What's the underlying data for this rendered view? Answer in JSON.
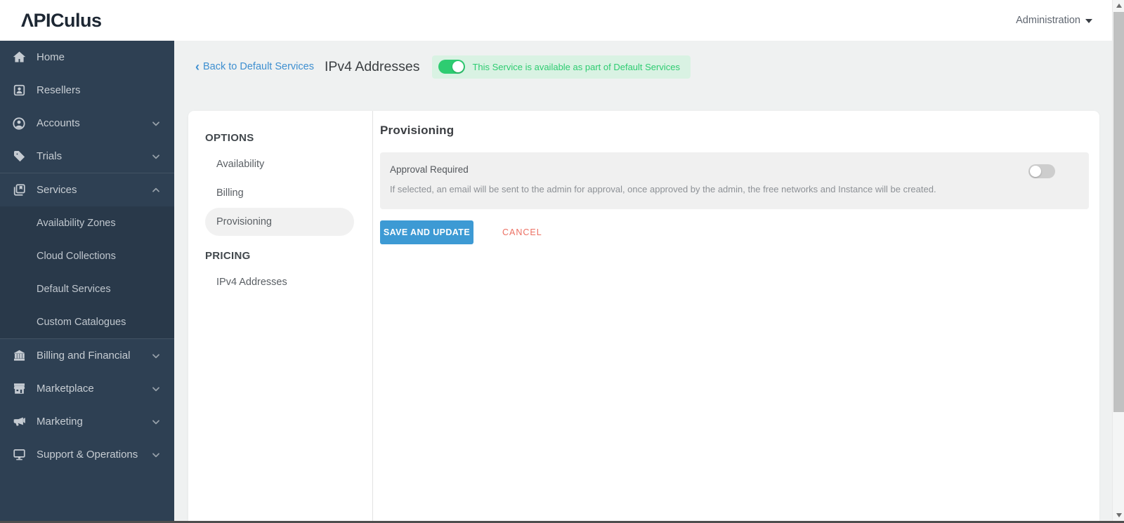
{
  "topbar": {
    "logo_text": "ΛPICulus",
    "admin_label": "Administration"
  },
  "sidebar": {
    "items": [
      {
        "label": "Home",
        "icon": "home"
      },
      {
        "label": "Resellers",
        "icon": "resellers"
      },
      {
        "label": "Accounts",
        "icon": "accounts",
        "chevron": "down"
      },
      {
        "label": "Trials",
        "icon": "trials",
        "chevron": "down"
      },
      {
        "label": "Services",
        "icon": "services",
        "chevron": "up",
        "expanded": true
      },
      {
        "label": "Billing and Financial",
        "icon": "billing",
        "chevron": "down"
      },
      {
        "label": "Marketplace",
        "icon": "marketplace",
        "chevron": "down"
      },
      {
        "label": "Marketing",
        "icon": "marketing",
        "chevron": "down"
      },
      {
        "label": "Support & Operations",
        "icon": "support",
        "chevron": "down"
      }
    ],
    "services_submenu": [
      "Availability Zones",
      "Cloud Collections",
      "Default Services",
      "Custom Catalogues"
    ]
  },
  "page_header": {
    "back_link": "Back to Default Services",
    "back_chevron": "‹",
    "title": "IPv4 Addresses",
    "service_badge": {
      "text": "This Service is available as part of Default Services",
      "toggle_state": "on"
    }
  },
  "options_menu": {
    "section1_header": "OPTIONS",
    "section1_items": [
      {
        "label": "Availability",
        "selected": false
      },
      {
        "label": "Billing",
        "selected": false
      },
      {
        "label": "Provisioning",
        "selected": true
      }
    ],
    "section2_header": "PRICING",
    "section2_items": [
      {
        "label": "IPv4 Addresses",
        "selected": false
      }
    ]
  },
  "content": {
    "heading": "Provisioning",
    "approval": {
      "label": "Approval Required",
      "description": "If selected, an email will be sent to the admin for approval, once approved by the admin, the free networks and Instance will be created.",
      "toggle_state": "off"
    },
    "save_label": "SAVE AND UPDATE",
    "cancel_label": "CANCEL"
  },
  "colors": {
    "sidebar_bg": "#2e4053",
    "accent_blue": "#3d9ad4",
    "link_blue": "#3e8fd0",
    "success_green": "#2ecc71",
    "badge_bg": "#d9f2e3",
    "cancel_red": "#ec7063",
    "page_bg": "#eff1f1"
  }
}
